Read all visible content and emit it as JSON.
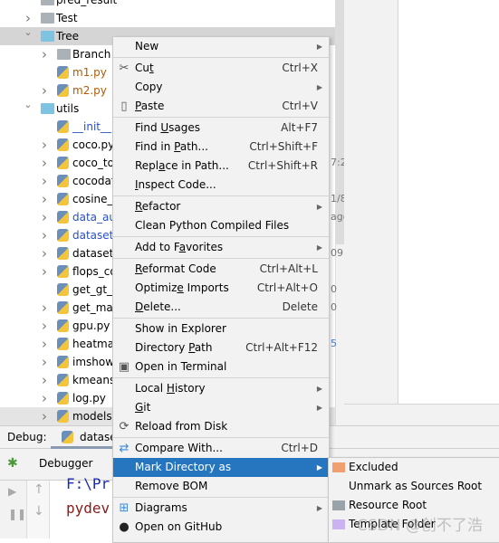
{
  "tree": {
    "rows": [
      {
        "label": "pred_result",
        "level": 1,
        "icon": "folder-icon",
        "chevron": "none"
      },
      {
        "label": "Test",
        "level": 1,
        "icon": "folder-icon",
        "chevron": "right"
      },
      {
        "label": "Tree",
        "level": 1,
        "icon": "folder-blue-icon",
        "chevron": "down",
        "selected": true
      },
      {
        "label": "Branch",
        "level": 2,
        "icon": "folder-icon",
        "chevron": "right"
      },
      {
        "label": "m1.py",
        "level": 2,
        "icon": "python-file-icon",
        "chevron": "none",
        "color": "orange"
      },
      {
        "label": "m2.py",
        "level": 2,
        "icon": "python-file-icon",
        "chevron": "right",
        "color": "orange"
      },
      {
        "label": "utils",
        "level": 1,
        "icon": "folder-blue-icon",
        "chevron": "down"
      },
      {
        "label": "__init__.p",
        "level": 2,
        "icon": "python-file-icon",
        "chevron": "none",
        "color": "blue"
      },
      {
        "label": "coco.py",
        "level": 2,
        "icon": "python-file-icon",
        "chevron": "right"
      },
      {
        "label": "coco_to",
        "level": 2,
        "icon": "python-file-icon",
        "chevron": "right"
      },
      {
        "label": "cocodat",
        "level": 2,
        "icon": "python-file-icon",
        "chevron": "right"
      },
      {
        "label": "cosine_l",
        "level": 2,
        "icon": "python-file-icon",
        "chevron": "right"
      },
      {
        "label": "data_au",
        "level": 2,
        "icon": "python-file-icon",
        "chevron": "right",
        "color": "blue"
      },
      {
        "label": "dataset",
        "level": 2,
        "icon": "python-file-icon",
        "chevron": "right",
        "color": "blue"
      },
      {
        "label": "dataset",
        "level": 2,
        "icon": "python-file-icon",
        "chevron": "right"
      },
      {
        "label": "flops_co",
        "level": 2,
        "icon": "python-file-icon",
        "chevron": "right"
      },
      {
        "label": "get_gt_t",
        "level": 2,
        "icon": "python-file-icon",
        "chevron": "none"
      },
      {
        "label": "get_map",
        "level": 2,
        "icon": "python-file-icon",
        "chevron": "right"
      },
      {
        "label": "gpu.py",
        "level": 2,
        "icon": "python-file-icon",
        "chevron": "right"
      },
      {
        "label": "heatma",
        "level": 2,
        "icon": "python-file-icon",
        "chevron": "right"
      },
      {
        "label": "imshow",
        "level": 2,
        "icon": "python-file-icon",
        "chevron": "right"
      },
      {
        "label": "kmeans",
        "level": 2,
        "icon": "python-file-icon",
        "chevron": "right"
      },
      {
        "label": "log.py",
        "level": 2,
        "icon": "python-file-icon",
        "chevron": "right"
      },
      {
        "label": "models",
        "level": 2,
        "icon": "python-file-icon",
        "chevron": "right",
        "hover": true
      }
    ],
    "fragments": [
      {
        "row": 9,
        "text": "7:2"
      },
      {
        "row": 11,
        "text": "1/8"
      },
      {
        "row": 12,
        "text": "ago"
      },
      {
        "row": 14,
        "text": "09"
      },
      {
        "row": 16,
        "text": "0"
      },
      {
        "row": 17,
        "text": "0"
      },
      {
        "row": 19,
        "text": "5"
      }
    ]
  },
  "debug": {
    "label": "Debug:",
    "config": "datase",
    "tab": "Debugger"
  },
  "console": {
    "lines": [
      {
        "text": "F:\\Pr",
        "color": "#1a2bb5"
      },
      {
        "text": "pydev",
        "color": "#8b1a1a"
      }
    ]
  },
  "menu": {
    "items": [
      {
        "label": "New",
        "arrow": true
      },
      {
        "sep": true
      },
      {
        "label": "Cut",
        "u": 2,
        "shortcut": "Ctrl+X",
        "icon": "scissors-icon"
      },
      {
        "label": "Copy",
        "arrow": true
      },
      {
        "label": "Paste",
        "u": 0,
        "shortcut": "Ctrl+V",
        "icon": "clipboard-icon"
      },
      {
        "sep": true
      },
      {
        "label": "Find Usages",
        "u": 5,
        "shortcut": "Alt+F7"
      },
      {
        "label": "Find in Path...",
        "u": 8,
        "shortcut": "Ctrl+Shift+F"
      },
      {
        "label": "Replace in Path...",
        "u": 4,
        "shortcut": "Ctrl+Shift+R"
      },
      {
        "label": "Inspect Code...",
        "u": 0
      },
      {
        "sep": true
      },
      {
        "label": "Refactor",
        "u": 0,
        "arrow": true
      },
      {
        "label": "Clean Python Compiled Files"
      },
      {
        "sep": true
      },
      {
        "label": "Add to Favorites",
        "u": 8,
        "arrow": true
      },
      {
        "sep": true
      },
      {
        "label": "Reformat Code",
        "u": 0,
        "shortcut": "Ctrl+Alt+L"
      },
      {
        "label": "Optimize Imports",
        "u": 7,
        "shortcut": "Ctrl+Alt+O"
      },
      {
        "label": "Delete...",
        "u": 0,
        "shortcut": "Delete"
      },
      {
        "sep": true
      },
      {
        "label": "Show in Explorer"
      },
      {
        "label": "Directory Path",
        "u": 10,
        "shortcut": "Ctrl+Alt+F12"
      },
      {
        "label": "Open in Terminal",
        "icon": "terminal-icon"
      },
      {
        "sep": true
      },
      {
        "label": "Local History",
        "u": 6,
        "arrow": true
      },
      {
        "label": "Git",
        "u": 0,
        "arrow": true
      },
      {
        "label": "Reload from Disk",
        "icon": "reload-icon"
      },
      {
        "sep": true
      },
      {
        "label": "Compare With...",
        "shortcut": "Ctrl+D",
        "icon": "compare-icon"
      },
      {
        "label": "Mark Directory as",
        "arrow": true,
        "highlighted": true
      },
      {
        "label": "Remove BOM"
      },
      {
        "sep": true
      },
      {
        "label": "Diagrams",
        "arrow": true,
        "icon": "diagram-icon"
      },
      {
        "label": "Open on GitHub",
        "icon": "github-icon"
      }
    ]
  },
  "submenu": {
    "items": [
      {
        "label": "Excluded",
        "icon": "excluded-folder-icon",
        "color": "#f0a070"
      },
      {
        "label": "Unmark as Sources Root"
      },
      {
        "label": "Resource Root",
        "icon": "resource-folder-icon",
        "color": "#9aa3aa"
      },
      {
        "label": "Template Folder",
        "icon": "template-folder-icon",
        "color": "#c9b3f0"
      }
    ]
  },
  "watermark": "CSDN @创不了浩",
  "colors": {
    "highlight": "#2675bf",
    "menu_bg": "#f2f2f2",
    "selected_row": "#d5d5d5"
  }
}
